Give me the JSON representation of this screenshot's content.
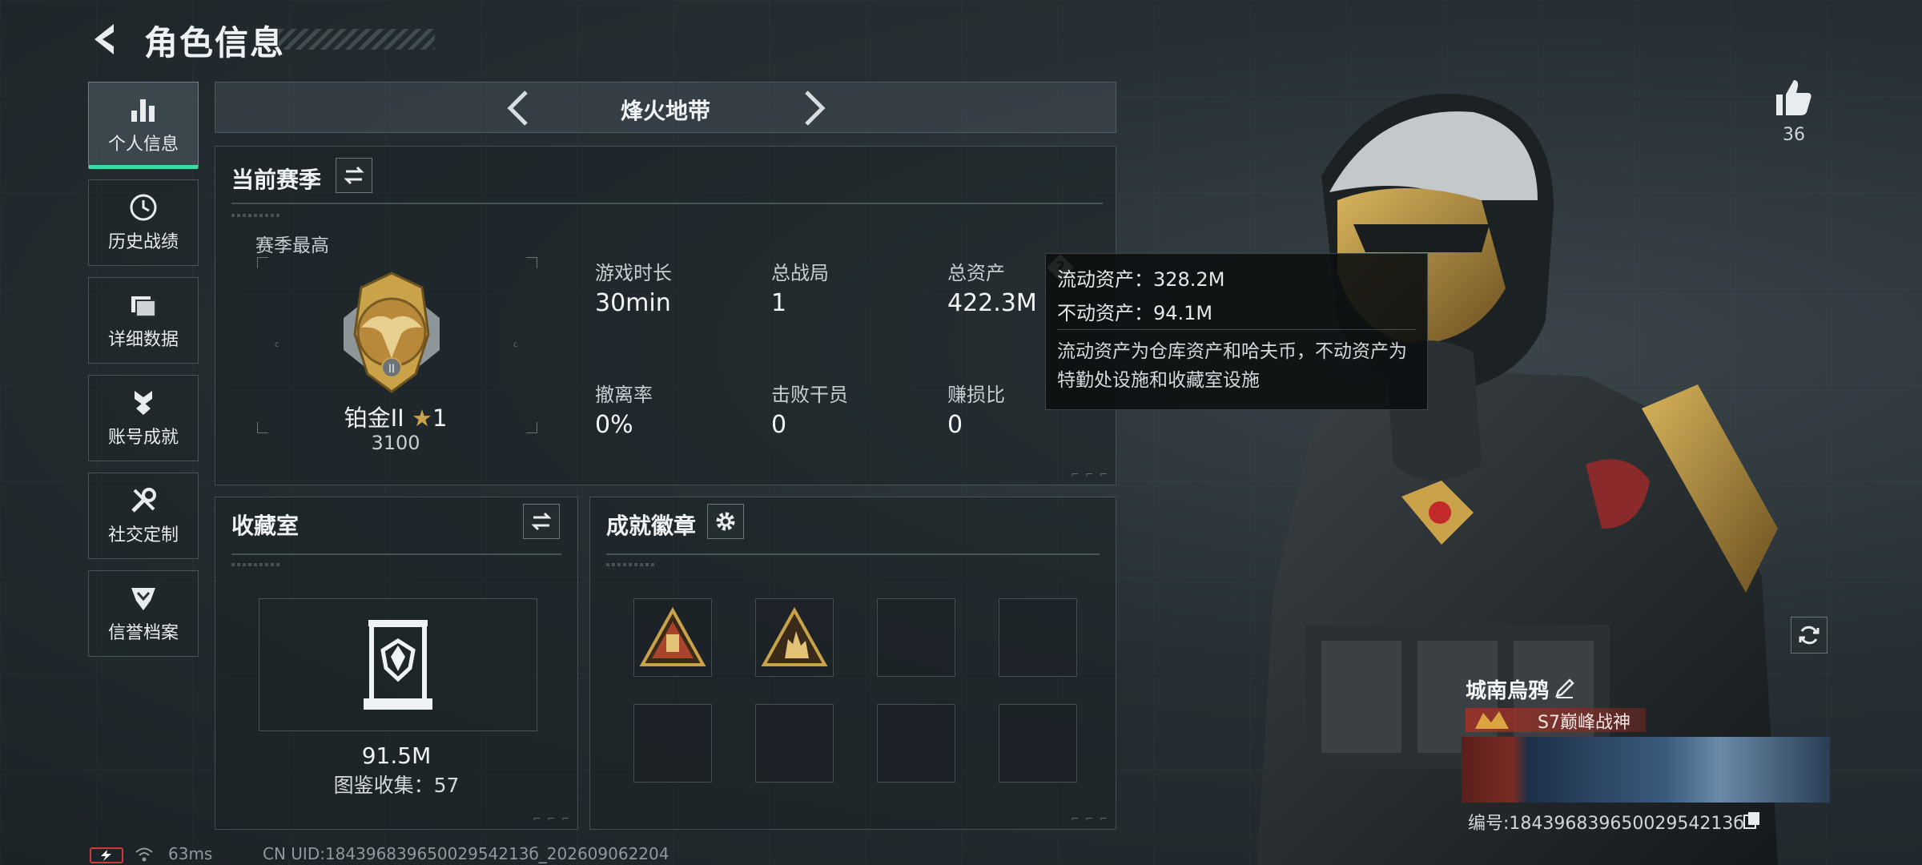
{
  "header": {
    "title": "角色信息"
  },
  "sidebar": {
    "items": [
      {
        "label": "个人信息",
        "icon": "bar-chart-icon",
        "active": true
      },
      {
        "label": "历史战绩",
        "icon": "clock-icon",
        "active": false
      },
      {
        "label": "详细数据",
        "icon": "folder-icon",
        "active": false
      },
      {
        "label": "账号成就",
        "icon": "medal-icon",
        "active": false
      },
      {
        "label": "社交定制",
        "icon": "tools-icon",
        "active": false
      },
      {
        "label": "信誉档案",
        "icon": "shield-icon",
        "active": false
      }
    ]
  },
  "mode": {
    "name": "烽火地带"
  },
  "season": {
    "title": "当前赛季",
    "best_label": "赛季最高",
    "rank_name": "铂金II",
    "rank_stars": "1",
    "rank_score": "3100",
    "stats": [
      {
        "label": "游戏时长",
        "value": "30min"
      },
      {
        "label": "总战局",
        "value": "1"
      },
      {
        "label": "总资产",
        "value": "422.3M"
      },
      {
        "label": "撤离率",
        "value": "0%"
      },
      {
        "label": "击败干员",
        "value": "0"
      },
      {
        "label": "赚损比",
        "value": "0"
      }
    ]
  },
  "tooltip": {
    "liquid": "流动资产：328.2M",
    "fixed": "不动资产：94.1M",
    "description": "流动资产为仓库资产和哈夫币，不动资产为特勤处设施和收藏室设施"
  },
  "collection": {
    "title": "收藏室",
    "value": "91.5M",
    "catalog": "图鉴收集：57"
  },
  "achievements": {
    "title": "成就徽章"
  },
  "player": {
    "likes": "36",
    "name": "城南烏鸦",
    "title_badge": "S7巅峰战神",
    "uid_text": "编号:18439683965002954213б"
  },
  "status": {
    "ping": "63ms",
    "cn_uid": "CN UID:18439683965002954213б_202609062204"
  },
  "colors": {
    "accent": "#3fd9a8",
    "gold": "#c9a24a",
    "danger": "#d23a3a"
  }
}
